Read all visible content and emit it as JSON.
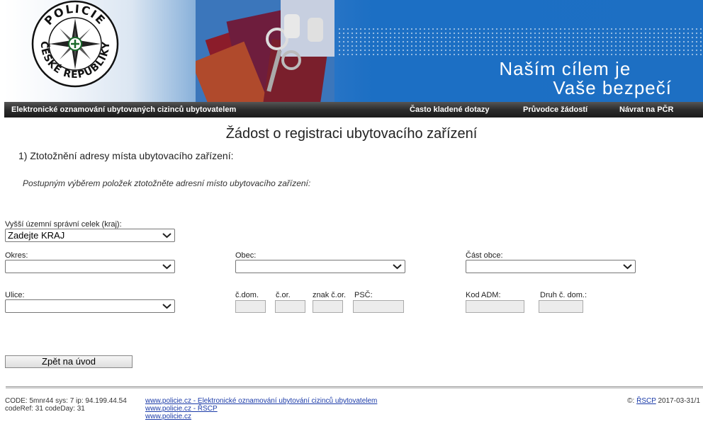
{
  "banner": {
    "logo_top_text": "POLICIE",
    "logo_bottom_text": "ČESKÉ REPUBLIKY",
    "slogan_line1": "Naším cílem je",
    "slogan_line2": "Vaše bezpečí"
  },
  "navbar": {
    "title": "Elektronické oznamování ubytovaných cizinců ubytovatelem",
    "faq": "Často kladené dotazy",
    "guide": "Průvodce žádostí",
    "back": "Návrat na PČR"
  },
  "page": {
    "title": "Žádost o registraci ubytovacího zařízení",
    "step": "1) Ztotožnění adresy místa ubytovacího zařízení:",
    "instruction": "Postupným výběrem položek ztotožněte adresní místo ubytovacího zařízení:"
  },
  "form": {
    "kraj_label": "Vyšší územní správní celek (kraj):",
    "kraj_value": "Zadejte KRAJ",
    "okres_label": "Okres:",
    "obec_label": "Obec:",
    "cast_obce_label": "Část obce:",
    "ulice_label": "Ulice:",
    "cdom_label": "č.dom.",
    "cor_label": "č.or.",
    "znak_label": "znak č.or.",
    "psc_label": "PSČ:",
    "kod_adm_label": "Kod ADM:",
    "druh_label": "Druh č. dom.:",
    "back_button": "Zpět na úvod"
  },
  "footer": {
    "code_line1": "CODE: 5mnr44 sys: 7 ip: 94.199.44.54",
    "code_line2": "codeRef: 31 codeDay: 31",
    "link1": "www.policie.cz - Elektronické oznamování ubytování cizinců ubytovatelem",
    "link2": "www.policie.cz - ŘSCP",
    "link3": "www.policie.cz",
    "copyright_prefix": "©: ",
    "copyright_link": "ŘSCP",
    "copyright_suffix": " 2017-03-31/1"
  }
}
